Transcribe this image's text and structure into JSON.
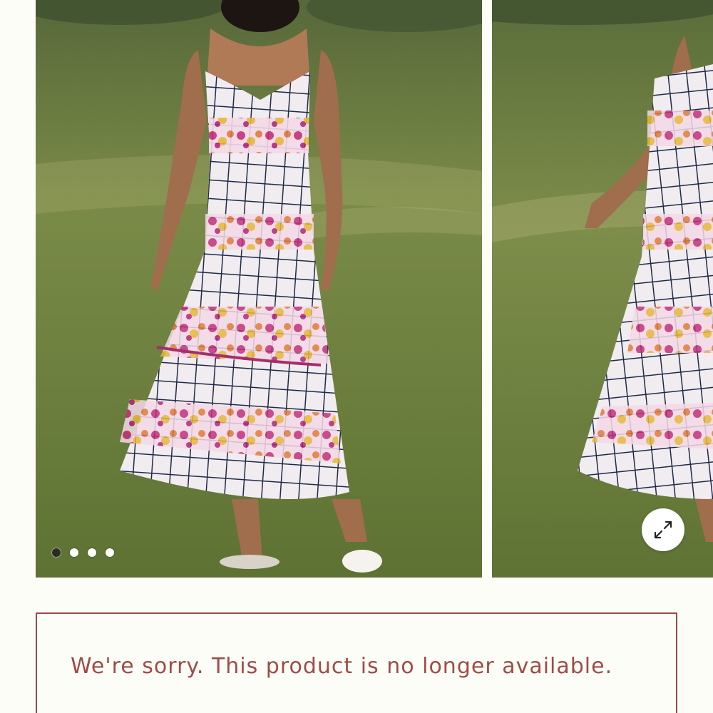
{
  "gallery": {
    "images": [
      {
        "alt": "",
        "icon": "product-photo-front"
      },
      {
        "alt": "",
        "icon": "product-photo-side"
      }
    ],
    "pagination": {
      "count": 4,
      "active_index": 0
    },
    "expand_icon": "expand-arrows-icon"
  },
  "notice": {
    "message": "We're sorry. This product is no longer available."
  },
  "colors": {
    "background": "#fdfdf8",
    "notice_border": "#9b4a44",
    "notice_text": "#a14b45",
    "grass": "#6e7f3c",
    "dress_grid": "#1f2a4a"
  }
}
